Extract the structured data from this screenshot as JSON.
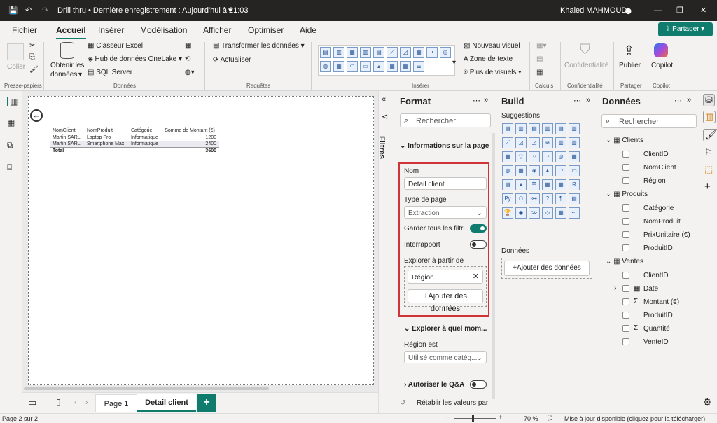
{
  "titlebar": {
    "title": "Drill thru • Dernière enregistrement : Aujourd'hui à 21:03",
    "user": "Khaled MAHMOUD"
  },
  "menu": [
    "Fichier",
    "Accueil",
    "Insérer",
    "Modélisation",
    "Afficher",
    "Optimiser",
    "Aide"
  ],
  "share_label": "Partager",
  "ribbon": {
    "coller": "Coller",
    "obtenir": "Obtenir les",
    "donnees_word": "données",
    "excel": "Classeur Excel",
    "onelake": "Hub de données OneLake",
    "sql": "SQL Server",
    "transformer": "Transformer les données",
    "actualiser": "Actualiser",
    "nouveau_visuel": "Nouveau visuel",
    "zone_texte": "Zone de texte",
    "plus_visuels": "Plus de visuels",
    "confidentialite": "Confidentialité",
    "publier": "Publier",
    "copilot": "Copilot",
    "groups": {
      "presse": "Presse-papiers",
      "donnees": "Données",
      "requetes": "Requêtes",
      "inserer": "Insérer",
      "calculs": "Calculs",
      "conf": "Confidentialité",
      "partager": "Partager",
      "copilot": "Copilot"
    }
  },
  "table": {
    "headers": [
      "NomClient",
      "NomProduit",
      "Catégorie",
      "Somme de Montant (€)"
    ],
    "rows": [
      [
        "Martin SARL",
        "Laptop Pro",
        "Informatique",
        "1200"
      ],
      [
        "Martin SARL",
        "Smartphone Max",
        "Informatique",
        "2400"
      ]
    ],
    "total_label": "Total",
    "total_value": "3600"
  },
  "filters_label": "Filtres",
  "format": {
    "title": "Format",
    "search": "Rechercher",
    "section1": "Informations sur la page",
    "nom_label": "Nom",
    "nom_value": "Detail client",
    "type_label": "Type de page",
    "type_value": "Extraction",
    "garder": "Garder tous les filtr...",
    "interrapport": "Interrapport",
    "explorer_label": "Explorer à partir de",
    "explorer_field": "Région",
    "ajouter": "+Ajouter des données",
    "section2": "Explorer à quel mom...",
    "region_est": "Région est",
    "utilise": "Utilisé comme catég...",
    "autoriser": "Autoriser le Q&A",
    "retablir": "Rétablir les valeurs par"
  },
  "build": {
    "title": "Build",
    "suggestions": "Suggestions",
    "donnees": "Données",
    "ajouter": "+Ajouter des données"
  },
  "data_pane": {
    "title": "Données",
    "search": "Rechercher",
    "tables": [
      {
        "name": "Clients",
        "fields": [
          "ClientID",
          "NomClient",
          "Région"
        ]
      },
      {
        "name": "Produits",
        "fields": [
          "Catégorie",
          "NomProduit",
          "PrixUnitaire (€)",
          "ProduitID"
        ]
      },
      {
        "name": "Ventes",
        "fields": [
          "ClientID",
          "Date",
          "Montant (€)",
          "ProduitID",
          "Quantité",
          "VenteID"
        ]
      }
    ]
  },
  "tabs": [
    "Page 1",
    "Detail client"
  ],
  "status": {
    "page": "Page 2 sur 2",
    "zoom": "70 %",
    "update": "Mise à jour disponible (cliquez pour la télécharger)"
  },
  "colors": {
    "accent": "#107c6e",
    "highlight": "#d13438",
    "title_bg": "#252423"
  }
}
